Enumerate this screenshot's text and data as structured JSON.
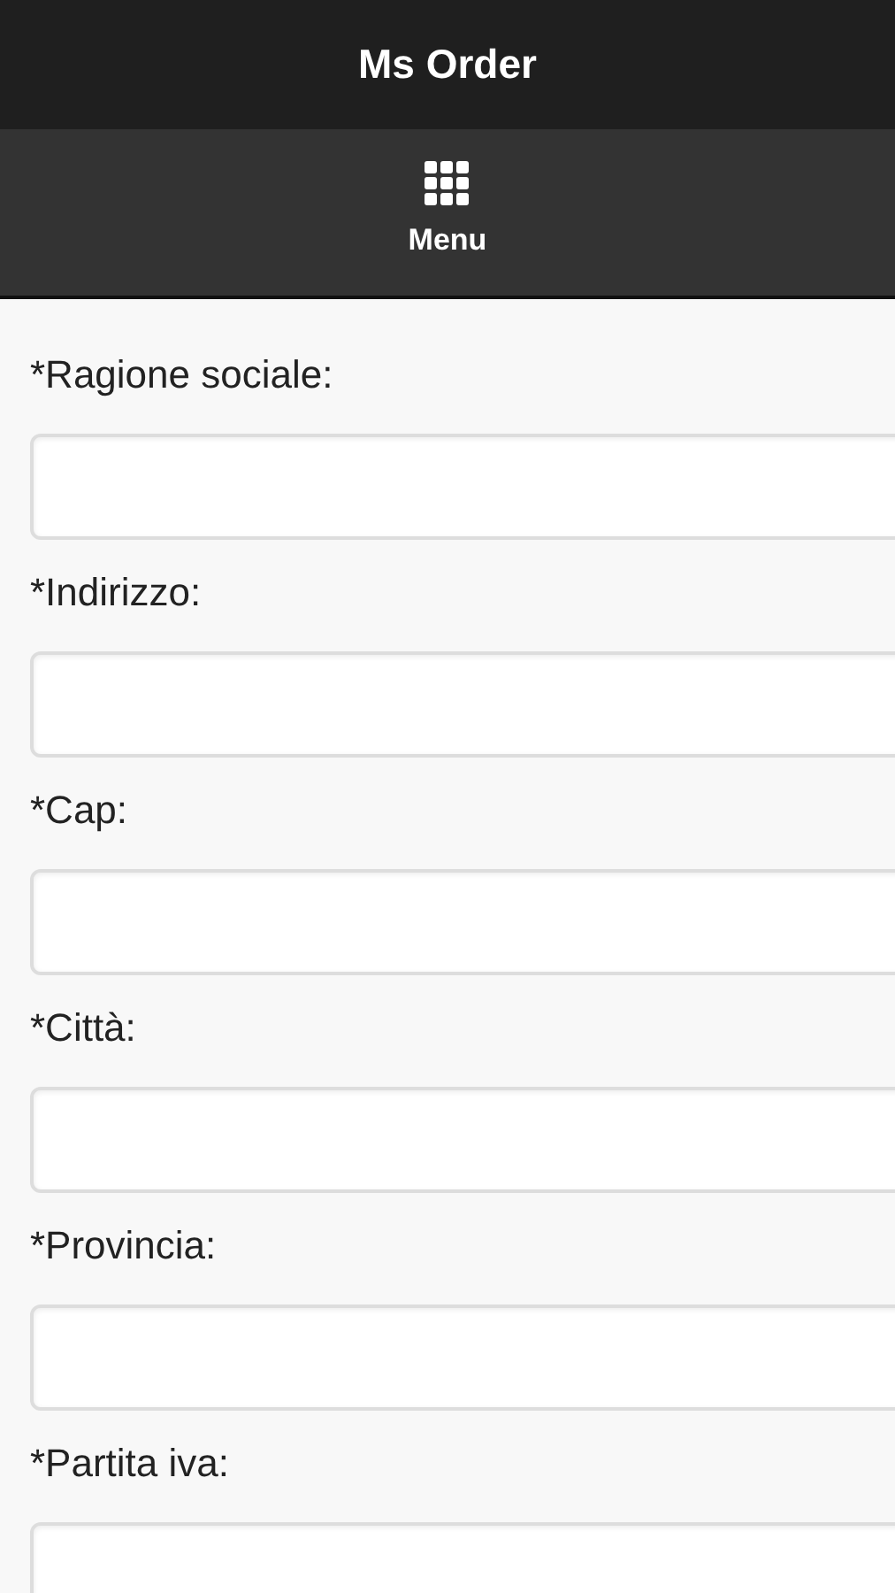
{
  "header": {
    "title": "Ms Order"
  },
  "nav": {
    "items": [
      {
        "label": "Menu"
      }
    ]
  },
  "form": {
    "fields": [
      {
        "label": "*Ragione sociale:"
      },
      {
        "label": "*Indirizzo:"
      },
      {
        "label": "*Cap:"
      },
      {
        "label": "*Città:"
      },
      {
        "label": "*Provincia:"
      },
      {
        "label": "*Partita iva:"
      }
    ]
  }
}
